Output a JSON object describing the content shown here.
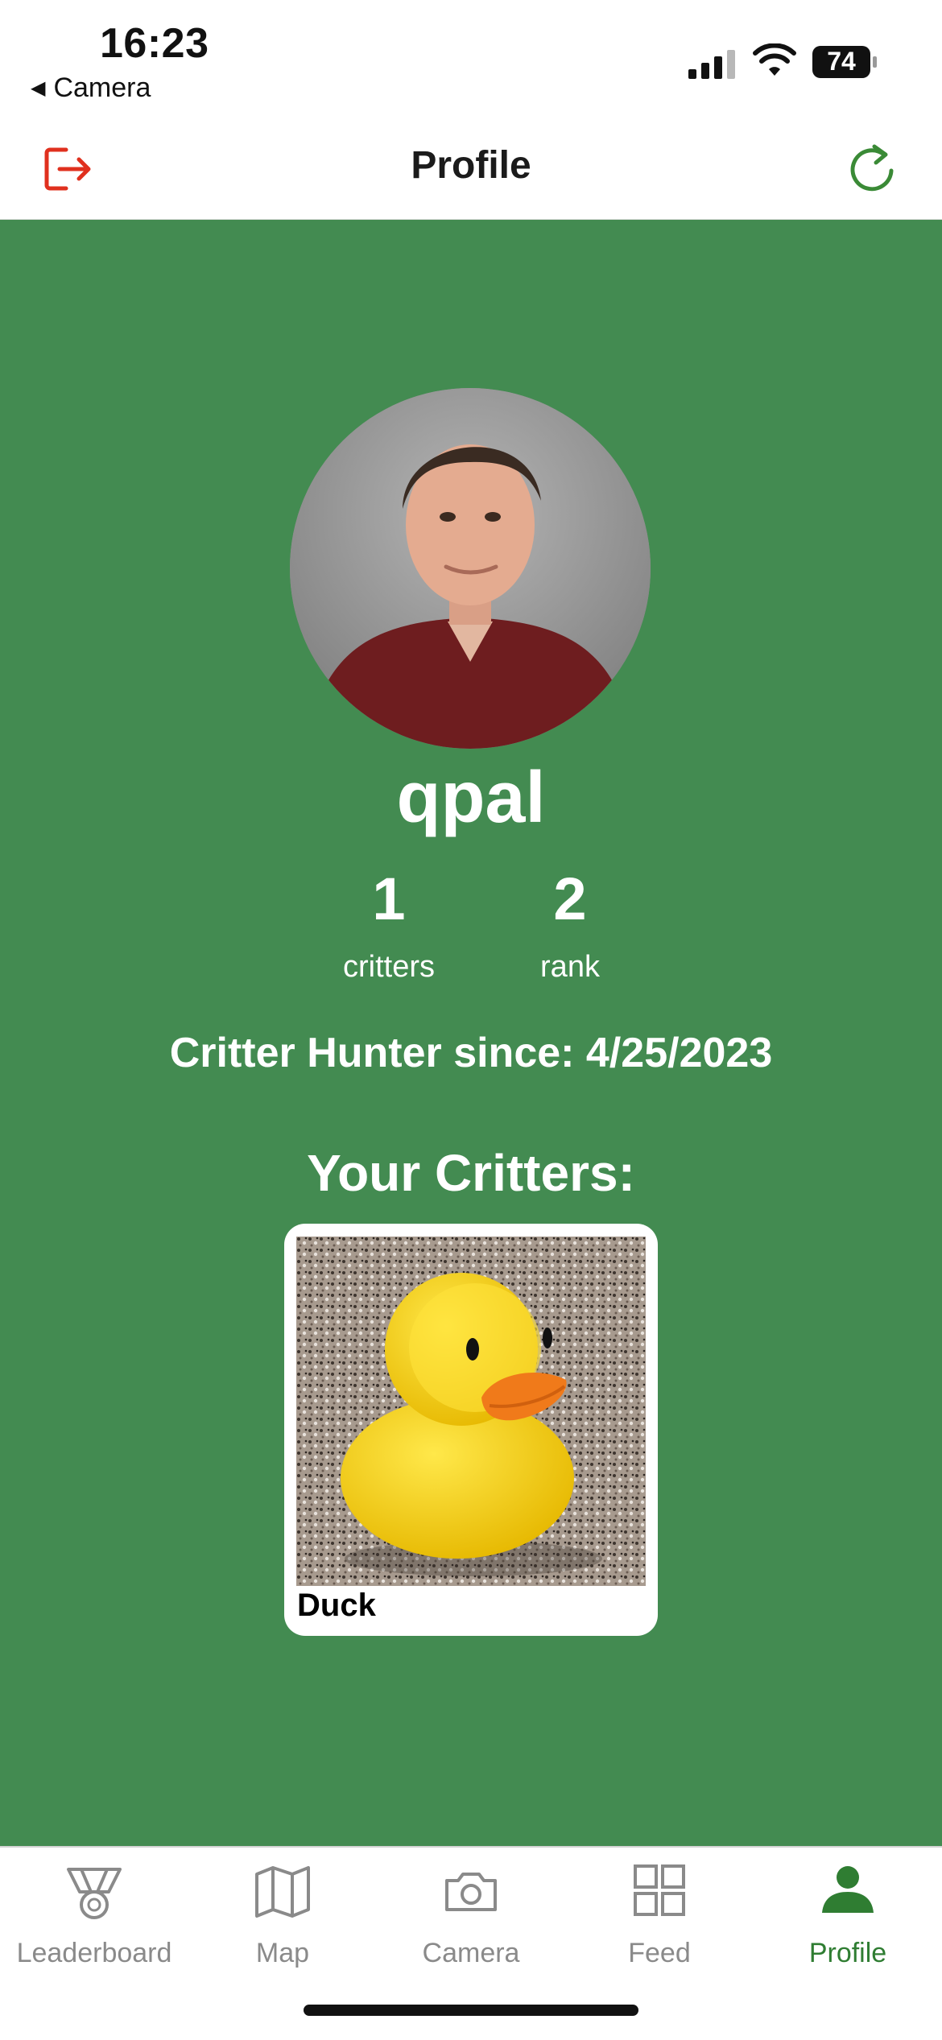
{
  "status_bar": {
    "time": "16:23",
    "back_app": "Camera",
    "battery": "74"
  },
  "header": {
    "title": "Profile"
  },
  "profile": {
    "username": "qpal",
    "critters_count": "1",
    "critters_label": "critters",
    "rank": "2",
    "rank_label": "rank",
    "since": "Critter Hunter since: 4/25/2023",
    "critters_title": "Your Critters:"
  },
  "critters": [
    {
      "name": "Duck"
    }
  ],
  "tabs": [
    {
      "label": "Leaderboard",
      "icon": "medal-icon"
    },
    {
      "label": "Map",
      "icon": "map-icon"
    },
    {
      "label": "Camera",
      "icon": "camera-icon"
    },
    {
      "label": "Feed",
      "icon": "grid-icon"
    },
    {
      "label": "Profile",
      "icon": "person-icon",
      "active": true
    }
  ],
  "colors": {
    "accent_green": "#438b51",
    "active_tab": "#2f7d32",
    "logout_red": "#e0301e"
  }
}
